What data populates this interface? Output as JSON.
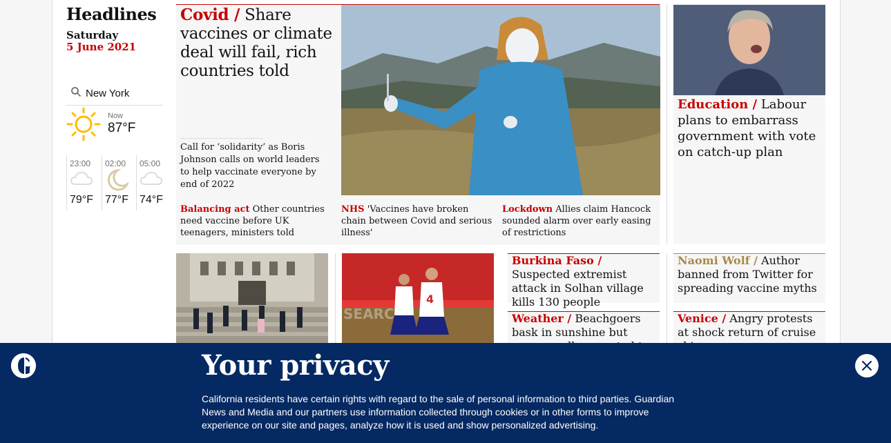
{
  "sidebar": {
    "title": "Headlines",
    "day": "Saturday",
    "date": "5 June 2021",
    "weather": {
      "location": "New York",
      "now_label": "Now",
      "now_temp": "87°F",
      "now_icon": "sun-icon",
      "forecast": [
        {
          "time": "23:00",
          "temp": "79°F",
          "icon": "cloud-icon"
        },
        {
          "time": "02:00",
          "temp": "77°F",
          "icon": "moon-icon"
        },
        {
          "time": "05:00",
          "temp": "74°F",
          "icon": "cloud-icon"
        }
      ]
    }
  },
  "lead": {
    "kicker": "Covid /",
    "headline": "Share vaccines or climate deal will fail, rich countries told",
    "standfirst": "Call for ‘solidarity’ as Boris Johnson calls on world leaders to help vaccinate everyone by end of 2022",
    "sublinks": [
      {
        "kicker": "Balancing act",
        "text": "Other countries need vaccine before UK teenagers, ministers told"
      },
      {
        "kicker": "NHS",
        "text": "'Vaccines have broken chain between Covid and serious illness'"
      },
      {
        "kicker": "Lockdown",
        "text": "Allies claim Hancock sounded alarm over early easing of restrictions"
      }
    ]
  },
  "education": {
    "kicker": "Education /",
    "headline": "Labour plans to embarrass government with vote on catch-up plan"
  },
  "row2": [
    {
      "kicker": "Burkina Faso /",
      "headline": "Suspected extremist attack in Solhan village kills 130 people"
    },
    {
      "kicker": "Weather /",
      "headline": "Beachgoers bask in sunshine but sunny spells expected to"
    },
    {
      "kicker": "Naomi Wolf /",
      "headline": "Author banned from Twitter for spreading vaccine myths"
    },
    {
      "kicker": "Venice /",
      "headline": "Angry protests at shock return of cruise ships"
    }
  ],
  "privacy": {
    "title": "Your privacy",
    "body": "California residents have certain rights with regard to the sale of personal information to third parties. Guardian News and Media and our partners use information collected through cookies or in other forms to improve experience on our site and pages, analyze how it is used and show personalized advertising."
  },
  "colors": {
    "accent_red": "#c70000",
    "tan": "#ab8849",
    "banner_blue": "#052962"
  }
}
